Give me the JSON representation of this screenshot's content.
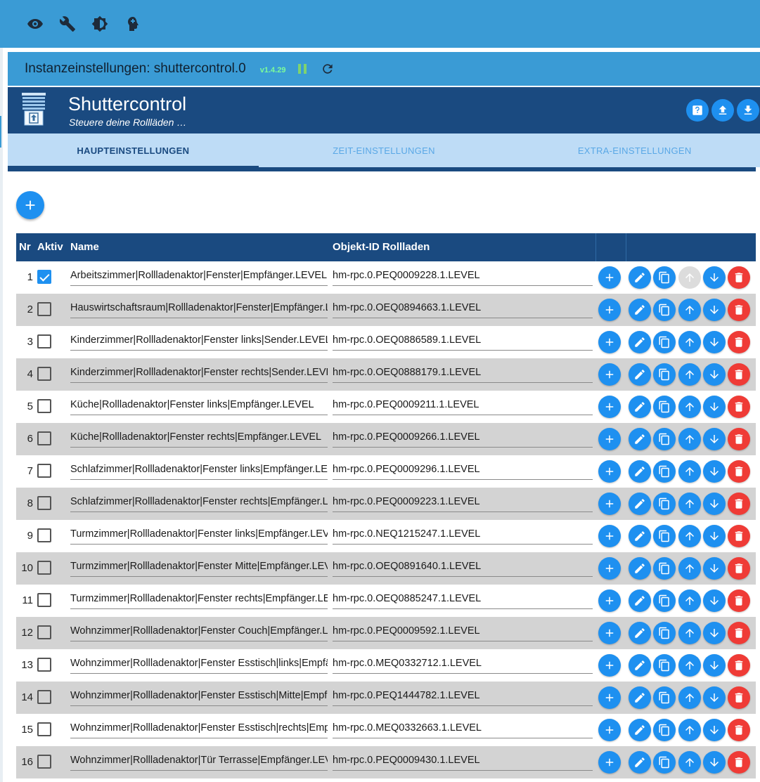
{
  "colors": {
    "topbar": "#3a9bd5",
    "header_dark": "#1a4a80",
    "tabs_bg": "#bedcf6",
    "button_blue": "#1e90f0",
    "button_red": "#ef3b36",
    "version_green": "#7CFC9a"
  },
  "topbar": {
    "icons": [
      "eye-icon",
      "wrench-icon",
      "brightness-icon",
      "head-icon"
    ]
  },
  "instance": {
    "title": "Instanzeinstellungen: shuttercontrol.0",
    "version": "v1.4.29"
  },
  "adapter": {
    "title": "Shuttercontrol",
    "subtitle": "Steuere deine Rollläden …"
  },
  "tabs": [
    {
      "label": "HAUPTEINSTELLUNGEN",
      "active": true
    },
    {
      "label": "ZEIT-EINSTELLUNGEN",
      "active": false
    },
    {
      "label": "EXTRA-EINSTELLUNGEN",
      "active": false
    }
  ],
  "table": {
    "headers": {
      "nr": "Nr",
      "aktiv": "Aktiv",
      "name": "Name",
      "object_id": "Objekt-ID Rollladen"
    },
    "rows": [
      {
        "nr": "1",
        "active": true,
        "name": "Arbeitszimmer|Rollladenaktor|Fenster|Empfänger.LEVEL",
        "object_id": "hm-rpc.0.PEQ0009228.1.LEVEL"
      },
      {
        "nr": "2",
        "active": false,
        "name": "Hauswirtschaftsraum|Rollladenaktor|Fenster|Empfänger.LEVEL",
        "object_id": "hm-rpc.0.OEQ0894663.1.LEVEL"
      },
      {
        "nr": "3",
        "active": false,
        "name": "Kinderzimmer|Rollladenaktor|Fenster links|Sender.LEVEL",
        "object_id": "hm-rpc.0.OEQ0886589.1.LEVEL"
      },
      {
        "nr": "4",
        "active": false,
        "name": "Kinderzimmer|Rollladenaktor|Fenster rechts|Sender.LEVEL",
        "object_id": "hm-rpc.0.OEQ0888179.1.LEVEL"
      },
      {
        "nr": "5",
        "active": false,
        "name": "Küche|Rollladenaktor|Fenster links|Empfänger.LEVEL",
        "object_id": "hm-rpc.0.PEQ0009211.1.LEVEL"
      },
      {
        "nr": "6",
        "active": false,
        "name": "Küche|Rollladenaktor|Fenster rechts|Empfänger.LEVEL",
        "object_id": "hm-rpc.0.PEQ0009266.1.LEVEL"
      },
      {
        "nr": "7",
        "active": false,
        "name": "Schlafzimmer|Rollladenaktor|Fenster links|Empfänger.LEVEL",
        "object_id": "hm-rpc.0.PEQ0009296.1.LEVEL"
      },
      {
        "nr": "8",
        "active": false,
        "name": "Schlafzimmer|Rollladenaktor|Fenster rechts|Empfänger.LEVEL",
        "object_id": "hm-rpc.0.PEQ0009223.1.LEVEL"
      },
      {
        "nr": "9",
        "active": false,
        "name": "Turmzimmer|Rollladenaktor|Fenster links|Empfänger.LEVEL",
        "object_id": "hm-rpc.0.NEQ1215247.1.LEVEL"
      },
      {
        "nr": "10",
        "active": false,
        "name": "Turmzimmer|Rollladenaktor|Fenster Mitte|Empfänger.LEVEL",
        "object_id": "hm-rpc.0.OEQ0891640.1.LEVEL"
      },
      {
        "nr": "11",
        "active": false,
        "name": "Turmzimmer|Rollladenaktor|Fenster rechts|Empfänger.LEVEL",
        "object_id": "hm-rpc.0.OEQ0885247.1.LEVEL"
      },
      {
        "nr": "12",
        "active": false,
        "name": "Wohnzimmer|Rollladenaktor|Fenster Couch|Empfänger.LEVEL",
        "object_id": "hm-rpc.0.PEQ0009592.1.LEVEL"
      },
      {
        "nr": "13",
        "active": false,
        "name": "Wohnzimmer|Rollladenaktor|Fenster Esstisch|links|Empfänger.LEVEL",
        "object_id": "hm-rpc.0.MEQ0332712.1.LEVEL"
      },
      {
        "nr": "14",
        "active": false,
        "name": "Wohnzimmer|Rollladenaktor|Fenster Esstisch|Mitte|Empfänger.LEVEL",
        "object_id": "hm-rpc.0.PEQ1444782.1.LEVEL"
      },
      {
        "nr": "15",
        "active": false,
        "name": "Wohnzimmer|Rollladenaktor|Fenster Esstisch|rechts|Empfänger.LEVEL",
        "object_id": "hm-rpc.0.MEQ0332663.1.LEVEL"
      },
      {
        "nr": "16",
        "active": false,
        "name": "Wohnzimmer|Rollladenaktor|Tür Terrasse|Empfänger.LEVEL",
        "object_id": "hm-rpc.0.PEQ0009430.1.LEVEL"
      }
    ]
  }
}
